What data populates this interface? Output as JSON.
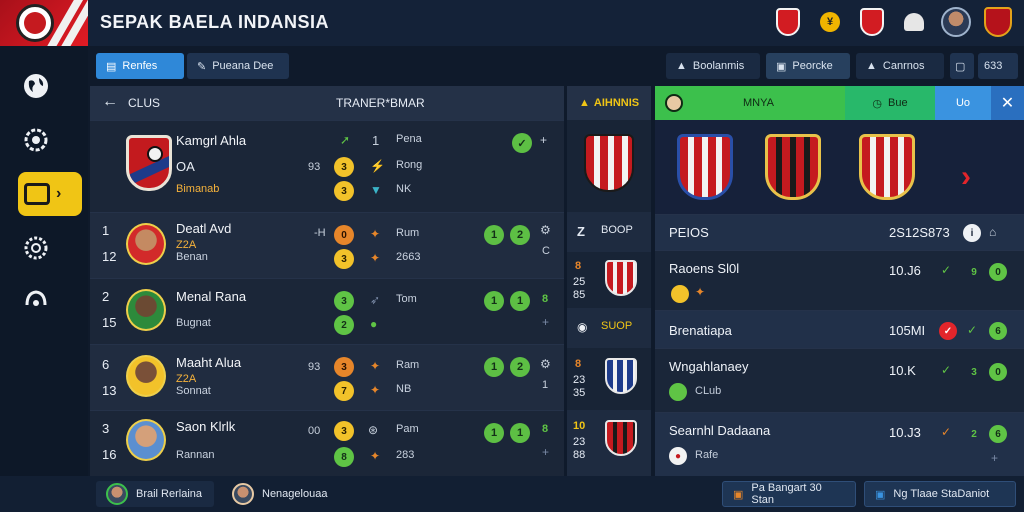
{
  "header": {
    "title": "SEPAK BAELA INDANSIA",
    "icons": [
      "shield-icon",
      "coin-icon",
      "shield-icon",
      "bell-icon",
      "user-avatar",
      "team-crest-icon"
    ],
    "coin_symbol": "¥"
  },
  "sidebar": {
    "items": [
      "globe-icon",
      "settings-gear-icon",
      "list-icon",
      "gear-icon",
      "home-icon"
    ]
  },
  "toolbar": {
    "left": [
      {
        "label": "Renfes",
        "active": true
      },
      {
        "label": "Pueana Dee",
        "active": false
      }
    ],
    "right": [
      {
        "label": "Boolanmis"
      },
      {
        "label": "Peorcke"
      },
      {
        "label": "Canrnos"
      },
      {
        "label": ""
      },
      {
        "label": "633"
      }
    ]
  },
  "left_panel": {
    "header_clubs": "CLUS",
    "header_title": "TRANER*BMAR",
    "top_entry": {
      "name": "Kamgrl Ahla",
      "sub1": "OA",
      "sub2": "Bimanab",
      "nums": [
        "1",
        "3",
        "3"
      ],
      "mark": "93",
      "labels": [
        "Pena",
        "Rong",
        "NK"
      ]
    },
    "players": [
      {
        "rank": "1",
        "rank2": "12",
        "name": "Deatl Avd",
        "team": "Benan",
        "tag": "Z2A",
        "mark": "-H",
        "c1": "0",
        "c2": "3",
        "l1": "Rum",
        "l2": "2663",
        "s1": "1",
        "s2": "2",
        "extra": "C"
      },
      {
        "rank": "2",
        "rank2": "15",
        "name": "Menal Rana",
        "team": "Bugnat",
        "tag": "",
        "mark": "",
        "c1": "3",
        "c2": "2",
        "l1": "Tom",
        "l2": "",
        "s1": "1",
        "s2": "1",
        "extra": "8"
      },
      {
        "rank": "6",
        "rank2": "13",
        "name": "Maaht Alua",
        "team": "Sonnat",
        "tag": "Z2A",
        "mark": "93",
        "c1": "3",
        "c2": "7",
        "l1": "Ram",
        "l2": "NB",
        "s1": "1",
        "s2": "2",
        "extra": "1"
      },
      {
        "rank": "3",
        "rank2": "16",
        "name": "Saon Klrlk",
        "team": "Rannan",
        "tag": "",
        "mark": "00",
        "c1": "3",
        "c2": "8",
        "l1": "Pam",
        "l2": "283",
        "s1": "1",
        "s2": "1",
        "extra": "8"
      }
    ]
  },
  "mid_panel": {
    "header": "AIHNNIS",
    "rows": [
      {
        "label": "BOOP",
        "num_top": "Z",
        "num_bottom": ""
      },
      {
        "label": "",
        "num_top": "8",
        "num_bottom": "25\n85"
      },
      {
        "label": "SUOP",
        "num_top": "",
        "num_bottom": ""
      },
      {
        "label": "",
        "num_top": "8",
        "num_bottom": "23\n35"
      },
      {
        "label": "",
        "num_top": "10",
        "num_bottom": "23\n88"
      }
    ]
  },
  "right_panel": {
    "tabs": {
      "tab1": "MNYA",
      "tab2": "Bue",
      "tab3": "Uo",
      "close": "✕"
    },
    "rows": [
      {
        "title": "PEIOS",
        "value": "2S12S873",
        "sub": ""
      },
      {
        "title": "Raoens Sl0l",
        "value": "10.J6",
        "sub": ""
      },
      {
        "title": "Brenatiapa",
        "value": "105MI",
        "sub": ""
      },
      {
        "title": "Wngahlanaey",
        "value": "10.K",
        "sub": "CLub"
      },
      {
        "title": "Searnhl Dadaana",
        "value": "10.J3",
        "sub": "Rafe"
      }
    ]
  },
  "bottom_bar": {
    "left1": "Brail Rerlaina",
    "left2": "Nenagelouaa",
    "right1": "Pa Bangart 30 Stan",
    "right2": "Ng Tlaae StaDaniot"
  }
}
